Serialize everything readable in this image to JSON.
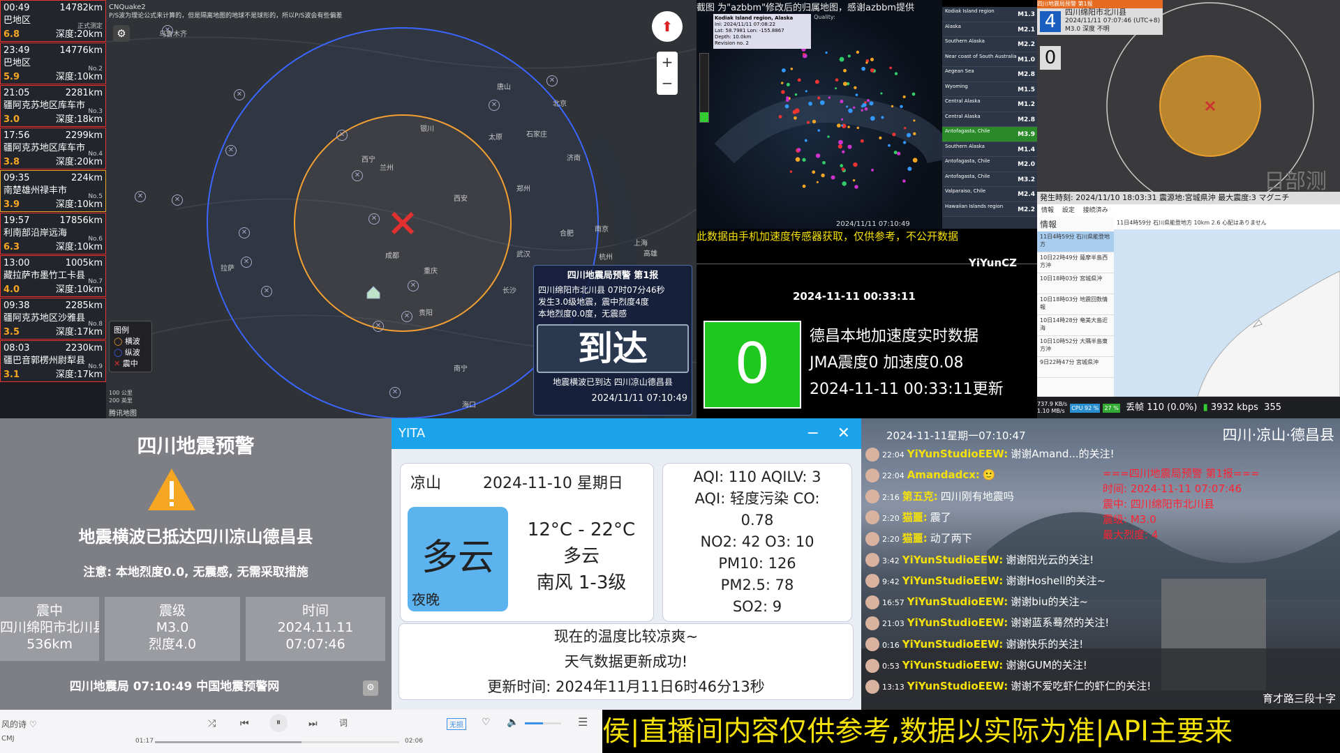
{
  "eq_list": [
    {
      "time": "00:49",
      "dist": "14782km",
      "loc": "巴地区",
      "no": "正式测定",
      "mag": "6.8",
      "depth": "深度:20km"
    },
    {
      "time": "23:49",
      "dist": "14776km",
      "loc": "巴地区",
      "no": "No.2",
      "mag": "5.9",
      "depth": "深度:10km"
    },
    {
      "time": "21:05",
      "dist": "2281km",
      "loc": "疆阿克苏地区库车市",
      "no": "No.3",
      "mag": "3.0",
      "depth": "深度:18km"
    },
    {
      "time": "17:56",
      "dist": "2299km",
      "loc": "疆阿克苏地区库车市",
      "no": "No.4",
      "mag": "3.8",
      "depth": "深度:20km"
    },
    {
      "time": "09:35",
      "dist": "224km",
      "loc": "南楚雄州禄丰市",
      "no": "No.5",
      "mag": "3.9",
      "depth": "深度:10km"
    },
    {
      "time": "19:57",
      "dist": "17856km",
      "loc": "利南部沿岸远海",
      "no": "No.6",
      "mag": "6.3",
      "depth": "深度:10km"
    },
    {
      "time": "13:00",
      "dist": "1005km",
      "loc": "藏拉萨市墨竹工卡县",
      "no": "No.7",
      "mag": "4.0",
      "depth": "深度:10km"
    },
    {
      "time": "09:38",
      "dist": "2285km",
      "loc": "疆阿克苏地区沙雅县",
      "no": "No.8",
      "mag": "3.5",
      "depth": "深度:17km"
    },
    {
      "time": "08:03",
      "dist": "2230km",
      "loc": "疆巴音郭楞州尉犁县",
      "no": "No.9",
      "mag": "3.1",
      "depth": "深度:17km"
    }
  ],
  "map": {
    "header_app": "CNQuake2",
    "header_note": "P/S波为理论公式来计算的，但是隔离地图的地球不是球形的，所以P/S波会有些偏差",
    "cities": [
      "乌鲁木齐",
      "银川",
      "西宁",
      "兰州",
      "西安",
      "太原",
      "石家庄",
      "济南",
      "郑州",
      "合肥",
      "南京",
      "上海",
      "杭州",
      "武汉",
      "长沙",
      "成都",
      "重庆",
      "贵阳",
      "拉萨",
      "北京",
      "南宁",
      "海口",
      "高雄",
      "唐山"
    ],
    "legend_title": "图例",
    "legend": [
      "横波",
      "纵波",
      "震中"
    ],
    "scale": [
      "100 公里",
      "200 英里"
    ],
    "watermark": "腾讯地图",
    "warn_title": "四川地震局预警 第1报",
    "warn_line1": "四川绵阳市北川县 07时07分46秒",
    "warn_line2": "发生3.0级地震，震中烈度4度",
    "warn_line3": "本地烈度0.0度，无震感",
    "arrive": "到达",
    "arrive_sub": "地震横波已到达 四川凉山德昌县",
    "timestamp": "2024/11/11 07:10:49"
  },
  "alaska": {
    "title_overlay": "截图 为\"azbbm\"修改后的归属地图，感谢azbbm提供",
    "event_loc": "Kodiak Island region, Alaska",
    "event_time": "Ini: 2024/11/11 07:08:22",
    "event_lat": "Lat: 58.7981 Lon: -155.8867",
    "event_depth": "Depth: 10.0km",
    "event_rev": "Revision no. 2",
    "quality": "Quality:",
    "map_time": "2024/11/11 07:10:49",
    "list": [
      {
        "loc": "Kodiak Island region",
        "m": "M1.3"
      },
      {
        "loc": "Alaska",
        "m": "M2.1"
      },
      {
        "loc": "Southern Alaska",
        "m": "M2.2"
      },
      {
        "loc": "Near coast of South Australia",
        "m": "M1.0"
      },
      {
        "loc": "Aegean Sea",
        "m": "M2.8"
      },
      {
        "loc": "Wyoming",
        "m": "M1.5"
      },
      {
        "loc": "Central Alaska",
        "m": "M1.2"
      },
      {
        "loc": "Central Alaska",
        "m": "M2.8"
      },
      {
        "loc": "Antofagasta, Chile",
        "m": "M3.9"
      },
      {
        "loc": "Southern Alaska",
        "m": "M1.4"
      },
      {
        "loc": "Antofagasta, Chile",
        "m": "M2.0"
      },
      {
        "loc": "Antofagasta, Chile",
        "m": "M3.2"
      },
      {
        "loc": "Valparaiso, Chile",
        "m": "M2.4"
      },
      {
        "loc": "Hawaiian Islands region",
        "m": "M2.2"
      }
    ],
    "phone_note": "此数据由手机加速度传感器获取，仅供参考，不公开数据",
    "author": "YiYunCZ",
    "accel_time": "2024-11-11 00:33:11",
    "accel_value": "0",
    "accel_title": "德昌本地加速度实时数据",
    "accel_line": "JMA震度0 加速度0.08",
    "accel_updated": "2024-11-11 00:33:11更新"
  },
  "rightmap": {
    "header": "四川地震局预警 第1报",
    "loc": "四川绵阳市北川县",
    "time": "2024/11/11 07:07:46 (UTC+8)",
    "mag": "M3.0  深度 不明",
    "count_top": "4",
    "count_bottom": "0",
    "watermark": "日部测试",
    "jp_bar": "発生時刻: 2024/11/10 18:03:31 震源地:宮城県沖 最大震度:3 マグニチ",
    "jp_tabs": [
      "情報",
      "設定",
      "接続済み"
    ],
    "jp_side_title": "情報",
    "jp_items": [
      "11日4時59分 石川県能登地方",
      "10日22時49分 薩摩半島西方沖",
      "10日18時03分 宮城県沖",
      "10日18時03分 地震回数情報",
      "10日14時28分 奄美大島近海",
      "10日10時52分 大隅半島東方沖",
      "9日22時47分 宮城県沖"
    ],
    "jp_head": "11日4時59分 石川県能登地方 10km 2.6 心配はありません",
    "status_net": "737.9 KB/s",
    "status_net2": "1.10 MB/s",
    "status_cpu": "CPU 92 %",
    "status_mem": "27 %",
    "status_drop": "丢帧 110 (0.0%)",
    "status_rate": "3932 kbps",
    "status_tail": "355"
  },
  "sichuan": {
    "title": "四川地震预警",
    "arrive_msg": "地震横波已抵达四川凉山德昌县",
    "note": "注意: 本地烈度0.0, 无震感, 无需采取措施",
    "h1": "震中",
    "v1a": "四川绵阳市北川县",
    "v1b": "536km",
    "h2": "震级",
    "v2a": "M3.0",
    "v2b": "烈度4.0",
    "h3": "时间",
    "v3a": "2024.11.11",
    "v3b": "07:07:46",
    "footer": "四川地震局  07:10:49  中国地震预警网"
  },
  "yita": {
    "title": "YITA",
    "city": "凉山",
    "date": "2024-11-10 星期日",
    "weather_big": "多云",
    "period": "夜晚",
    "temp": "12°C - 22°C",
    "weather": "多云",
    "wind": "南风 1-3级",
    "aqi_line1": "AQI: 110  AQILV: 3",
    "aqi_line2": "AQI: 轻度污染  CO:",
    "aqi_line3": "0.78",
    "aqi_line4": "NO2: 42  O3: 10",
    "aqi_line5": "PM10: 126",
    "aqi_line6": "PM2.5: 78",
    "aqi_line7": "SO2: 9",
    "msg1": "现在的温度比较凉爽~",
    "msg2": "天气数据更新成功!",
    "msg3": "更新时间: 2024年11月11日6时46分13秒"
  },
  "chat": {
    "clock": "2024-11-11星期一07:10:47",
    "place": "四川·凉山·德昌县",
    "ov_title": "===四川地震局预警 第1报===",
    "ov_time": "时间: 2024-11-11 07:07:46",
    "ov_epic": "震中: 四川绵阳市北川县",
    "ov_mag": "震级: M3.0",
    "ov_int": "最大烈度: 4",
    "street": "育才路三段十字",
    "lines": [
      {
        "t": "22:04",
        "u": "YiYunStudioEEW:",
        "m": "谢谢Amand...的关注!"
      },
      {
        "t": "22:04",
        "u": "Amandadcx:",
        "m": "🙂"
      },
      {
        "t": "2:16",
        "u": "第五克:",
        "m": "四川刚有地震吗"
      },
      {
        "t": "2:20",
        "u": "猫噩:",
        "m": "震了"
      },
      {
        "t": "2:20",
        "u": "猫噩:",
        "m": "动了两下"
      },
      {
        "t": "3:42",
        "u": "YiYunStudioEEW:",
        "m": "谢谢阳光云的关注!"
      },
      {
        "t": "9:42",
        "u": "YiYunStudioEEW:",
        "m": "谢谢Hoshell的关注~"
      },
      {
        "t": "16:57",
        "u": "YiYunStudioEEW:",
        "m": "谢谢biu的关注~"
      },
      {
        "t": "21:03",
        "u": "YiYunStudioEEW:",
        "m": "谢谢蓝系蓦然的关注!"
      },
      {
        "t": "0:16",
        "u": "YiYunStudioEEW:",
        "m": "谢谢快乐的关注!"
      },
      {
        "t": "0:53",
        "u": "YiYunStudioEEW:",
        "m": "谢谢GUM的关注!"
      },
      {
        "t": "13:13",
        "u": "YiYunStudioEEW:",
        "m": "谢谢不爱吃虾仁的虾仁的关注!"
      }
    ]
  },
  "player": {
    "song": "风的诗",
    "artist": "CMJ",
    "time_now": "01:17",
    "time_total": "02:06",
    "lossless": "无损",
    "lyric": "词",
    "progress": 0.6,
    "volume": 0.5
  },
  "ticker": "侯|直播间内容仅供参考,数据以实际为准|API主要来"
}
